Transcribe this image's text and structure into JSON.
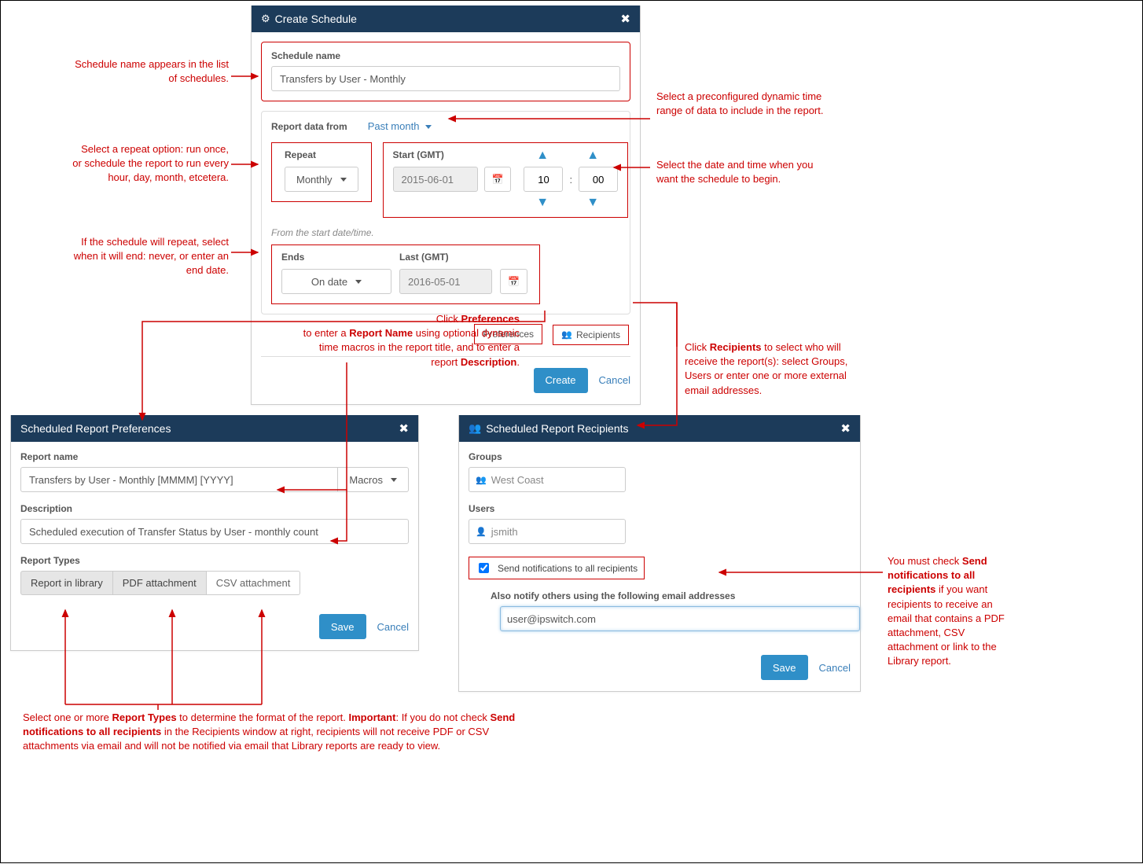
{
  "createSchedule": {
    "title": "Create Schedule",
    "scheduleName": {
      "label": "Schedule name",
      "value": "Transfers by User - Monthly"
    },
    "reportDataFrom": {
      "label": "Report data from",
      "value": "Past month"
    },
    "repeat": {
      "label": "Repeat",
      "value": "Monthly"
    },
    "start": {
      "label": "Start (GMT)",
      "date": "2015-06-01",
      "hour": "10",
      "minute": "00"
    },
    "fromStart": "From the start date/time.",
    "ends": {
      "label": "Ends",
      "value": "On date"
    },
    "last": {
      "label": "Last (GMT)",
      "date": "2016-05-01"
    },
    "tabs": {
      "preferences": "Preferences",
      "recipients": "Recipients"
    },
    "buttons": {
      "create": "Create",
      "cancel": "Cancel"
    }
  },
  "preferences": {
    "title": "Scheduled Report Preferences",
    "reportName": {
      "label": "Report name",
      "value": "Transfers by User - Monthly [MMMM] [YYYY]",
      "macros": "Macros"
    },
    "description": {
      "label": "Description",
      "value": "Scheduled execution of Transfer Status by User - monthly count"
    },
    "types": {
      "label": "Report Types",
      "library": "Report in library",
      "pdf": "PDF attachment",
      "csv": "CSV attachment"
    },
    "buttons": {
      "save": "Save",
      "cancel": "Cancel"
    }
  },
  "recipients": {
    "title": "Scheduled Report Recipients",
    "groups": {
      "label": "Groups",
      "value": "West Coast"
    },
    "users": {
      "label": "Users",
      "value": "jsmith"
    },
    "sendAll": "Send notifications to all recipients",
    "alsoNotify": {
      "label": "Also notify others using the following email addresses",
      "value": "user@ipswitch.com"
    },
    "buttons": {
      "save": "Save",
      "cancel": "Cancel"
    }
  },
  "annotations": {
    "scheduleName": "Schedule name appears in the list of schedules.",
    "repeat": "Select a repeat option: run once, or schedule the report to run every hour, day, month, etcetera.",
    "ends": "If the schedule will repeat, select when it will end: never, or enter an end date.",
    "timeRange": "Select a preconfigured dynamic time range of data to include in the report.",
    "dateTime": "Select the date and time when you want the schedule to begin.",
    "preferences_prefix": "Click ",
    "preferences_bold1": "Preferences",
    "preferences_mid1": " to enter a ",
    "preferences_bold2": "Report Name",
    "preferences_mid2": " using optional dynamic time macros in the report title, and to enter a report ",
    "preferences_bold3": "Description",
    "preferences_end": ".",
    "recipients_prefix": "Click ",
    "recipients_bold": "Recipients",
    "recipients_rest": " to select who will receive the report(s): select Groups, Users or enter one or more external email addresses.",
    "types_prefix": "Select one or more ",
    "types_bold1": "Report Types",
    "types_mid": " to determine the format of the report. ",
    "types_bold2": "Important",
    "types_mid2": ": If you do not check ",
    "types_bold3": "Send notifications to all recipients",
    "types_rest": " in the Recipients window at right, recipients will not receive PDF or CSV attachments via email and will not be notified via email that Library reports are ready to view.",
    "sendAll_prefix": "You must check ",
    "sendAll_bold": "Send notifications to all recipients",
    "sendAll_rest": " if you want recipients to receive an email that contains a PDF attachment, CSV attachment or link to the Library report."
  }
}
